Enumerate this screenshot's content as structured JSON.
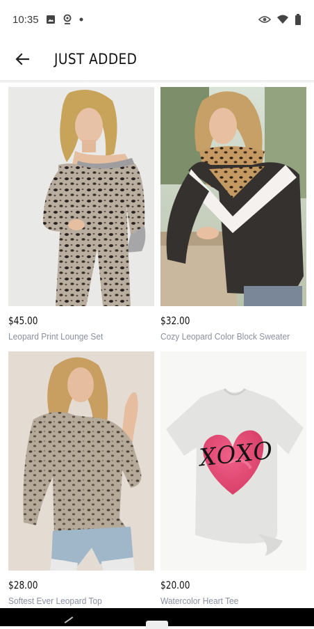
{
  "status_bar": {
    "time": "10:35",
    "left_icons": [
      "image-icon",
      "location-icon",
      "dot-icon"
    ],
    "right_icons": [
      "eye-icon",
      "wifi-icon",
      "battery-icon"
    ]
  },
  "app_bar": {
    "title": "JUST ADDED",
    "back_icon": "arrow-left-icon"
  },
  "products": [
    {
      "price": "$45.00",
      "name": "Leopard Print Lounge Set"
    },
    {
      "price": "$32.00",
      "name": "Cozy Leopard Color Block Sweater"
    },
    {
      "price": "$28.00",
      "name": "Softest Ever Leopard Top"
    },
    {
      "price": "$20.00",
      "name": "Watercolor Heart Tee",
      "print": "XOXO"
    }
  ],
  "colors": {
    "price_text": "#111111",
    "name_text": "#8a8fa0",
    "heart": "#e0446b"
  }
}
